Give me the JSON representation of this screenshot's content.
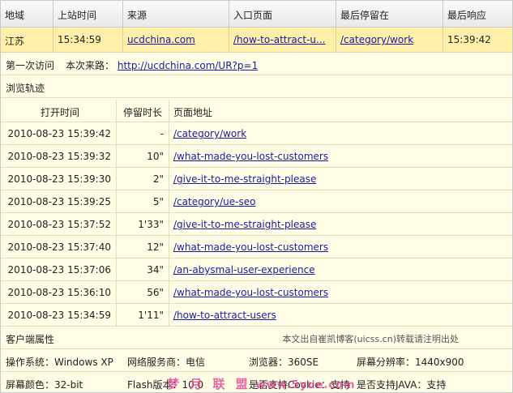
{
  "header": {
    "region": "地域",
    "arrival_time": "上站时间",
    "source": "来源",
    "entry_page": "入口页面",
    "last_page": "最后停留在",
    "last_response": "最后响应"
  },
  "visit": {
    "region": "江苏",
    "arrival_time": "15:34:59",
    "source": "ucdchina.com",
    "entry_page": "/how-to-attract-u...",
    "last_page": "/category/work",
    "last_response": "15:39:42"
  },
  "visit_info": {
    "first_visit": "第一次访问",
    "referrer_label": "本次来路：",
    "referrer_url": "http://ucdchina.com/UR?p=1"
  },
  "tracking": {
    "title": "浏览轨迹",
    "columns": [
      "打开时间",
      "停留时长",
      "页面地址"
    ],
    "rows": [
      {
        "time": "2010-08-23 15:39:42",
        "duration": "-",
        "url": "/category/work"
      },
      {
        "time": "2010-08-23 15:39:32",
        "duration": "10\"",
        "url": "/what-made-you-lost-customers"
      },
      {
        "time": "2010-08-23 15:39:30",
        "duration": "2\"",
        "url": "/give-it-to-me-straight-please"
      },
      {
        "time": "2010-08-23 15:39:25",
        "duration": "5\"",
        "url": "/category/ue-seo"
      },
      {
        "time": "2010-08-23 15:37:52",
        "duration": "1'33\"",
        "url": "/give-it-to-me-straight-please"
      },
      {
        "time": "2010-08-23 15:37:40",
        "duration": "12\"",
        "url": "/what-made-you-lost-customers"
      },
      {
        "time": "2010-08-23 15:37:06",
        "duration": "34\"",
        "url": "/an-abysmal-user-experience"
      },
      {
        "time": "2010-08-23 15:36:10",
        "duration": "56\"",
        "url": "/what-made-you-lost-customers"
      },
      {
        "time": "2010-08-23 15:34:59",
        "duration": "1'11\"",
        "url": "/how-to-attract-users"
      }
    ]
  },
  "client": {
    "title": "客户端属性",
    "credit": "本文出自崔凯博客(uicss.cn)转载请注明出处",
    "os": "操作系统：Windows XP",
    "isp": "网络服务商：电信",
    "browser": "浏览器：360SE",
    "resolution": "屏幕分辨率：1440x900",
    "color": "屏幕颜色：32-bit",
    "flash": "Flash版本：10.0",
    "cookie": "是否支持Cookie：支持",
    "java": "是否支持JAVA：支持"
  },
  "watermark": {
    "brand": "梦 月 联 盟",
    "site": "www.5yue.com"
  },
  "colors": {
    "background": "#fffde6",
    "selected_row": "#ffefa8",
    "link": "#1a1aa8",
    "watermark": "#e24b9a"
  }
}
